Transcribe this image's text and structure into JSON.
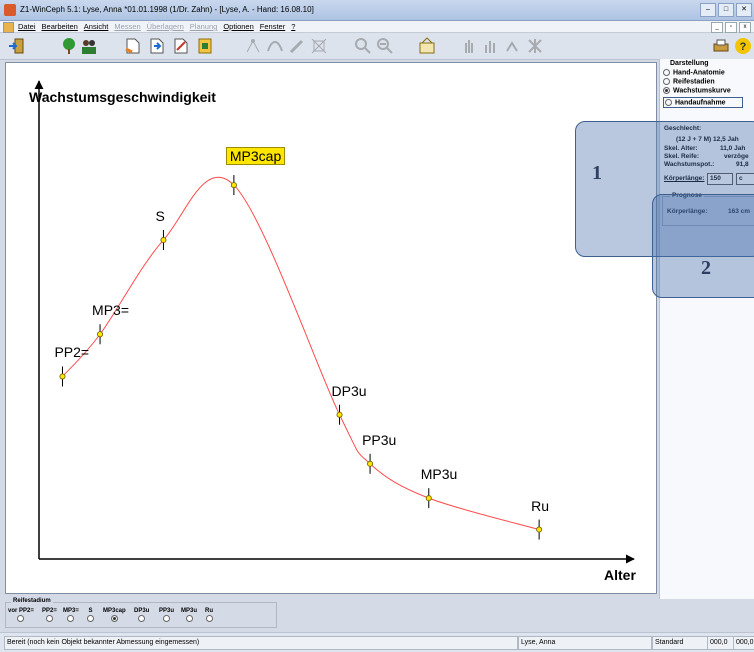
{
  "window": {
    "title": "Z1-WinCeph 5.1: Lyse, Anna *01.01.1998 (1/Dr. Zahn) - [Lyse, A. - Hand: 16.08.10]"
  },
  "menu": {
    "items": [
      "Datei",
      "Bearbeiten",
      "Ansicht",
      "Messen",
      "Überlagern",
      "Planung",
      "Optionen",
      "Fenster",
      "?"
    ]
  },
  "chart_data": {
    "type": "line",
    "title": "Wachstumsgeschwindigkeit",
    "xlabel": "Alter",
    "ylabel": "",
    "curve_color": "#ff4a4a",
    "highlight_color": "#ffe600",
    "points": [
      {
        "label": "PP2=",
        "x": 1.0,
        "y": 1.56
      },
      {
        "label": "MP3=",
        "x": 2.6,
        "y": 1.99
      },
      {
        "label": "S",
        "x": 5.3,
        "y": 2.95
      },
      {
        "label": "MP3cap",
        "x": 8.3,
        "y": 3.51,
        "highlight": true
      },
      {
        "label": "DP3u",
        "x": 12.8,
        "y": 1.17
      },
      {
        "label": "PP3u",
        "x": 14.1,
        "y": 0.67
      },
      {
        "label": "MP3u",
        "x": 16.6,
        "y": 0.32
      },
      {
        "label": "Ru",
        "x": 21.3,
        "y": 0.0
      }
    ],
    "xlim": [
      0,
      25
    ],
    "ylim": [
      -0.3,
      4.55
    ]
  },
  "panel": {
    "group_title": "Darstellung",
    "options": [
      {
        "label": "Hand-Anatomie",
        "selected": false
      },
      {
        "label": "Reifestadien",
        "selected": false
      },
      {
        "label": "Wachstumskurve",
        "selected": true
      },
      {
        "label": "Handaufnahme",
        "selected": false
      }
    ],
    "info_header": "Geschlecht:",
    "age_line": "(12 J + 7 M)  12,5 Jah",
    "skel_alter_label": "Skel. Alter:",
    "skel_alter_value": "11,0 Jah",
    "skel_reife_label": "Skel. Reife:",
    "skel_reife_value": "verzöge",
    "wachstumspot_label": "Wachstumspot.:",
    "wachstumspot_value": "91,8",
    "koerperlaenge_label": "Körperlänge:",
    "koerperlaenge_value": "150",
    "koerperlaenge_unit": "c",
    "prognose_title": "Prognose",
    "prognose_label": "Körperlänge:",
    "prognose_value": "163 cm"
  },
  "callouts": [
    "1",
    "2"
  ],
  "stages": {
    "group_title": "Reifestadium",
    "items": [
      {
        "label": "vor PP2=",
        "selected": false
      },
      {
        "label": "PP2=",
        "selected": false
      },
      {
        "label": "MP3=",
        "selected": false
      },
      {
        "label": "S",
        "selected": false
      },
      {
        "label": "MP3cap",
        "selected": true
      },
      {
        "label": "DP3u",
        "selected": false
      },
      {
        "label": "PP3u",
        "selected": false
      },
      {
        "label": "MP3u",
        "selected": false
      },
      {
        "label": "Ru",
        "selected": false
      }
    ]
  },
  "status": {
    "message": "Bereit (noch kein Objekt bekannter Abmessung eingemessen)",
    "patient": "Lyse, Anna",
    "mode": "Standard",
    "coord_x": "000,0",
    "coord_y": "000,0"
  }
}
